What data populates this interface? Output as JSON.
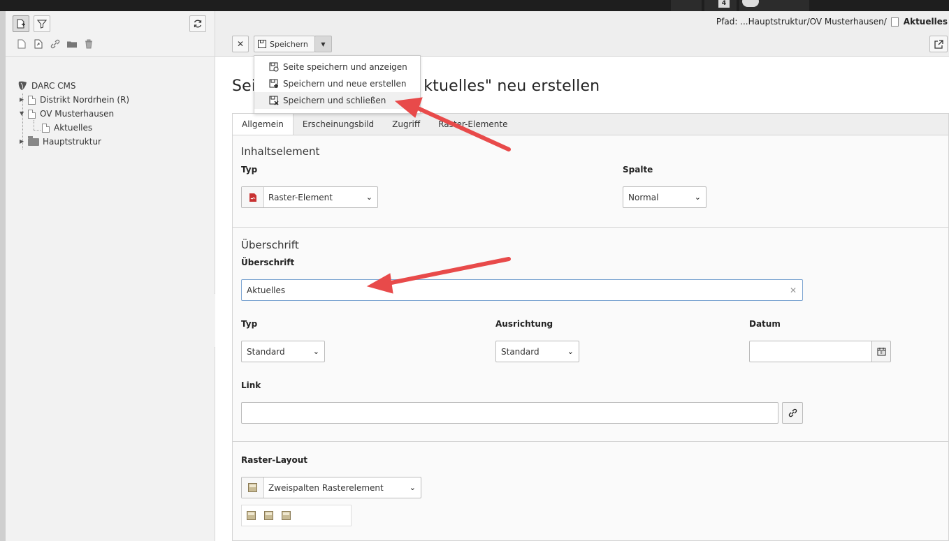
{
  "topbar": {
    "badge": "4"
  },
  "tree": {
    "root": "DARC CMS",
    "items": [
      {
        "label": "Distrikt Nordrhein (R)"
      },
      {
        "label": "OV Musterhausen"
      },
      {
        "label": "Aktuelles"
      },
      {
        "label": "Hauptstruktur"
      }
    ]
  },
  "header": {
    "path_prefix": "Pfad: ...Hauptstruktur/OV Musterhausen/",
    "path_current": "Aktuelles",
    "close_label": "✕",
    "save_label": "Speichern"
  },
  "save_menu": {
    "items": [
      {
        "label": "Seite speichern und anzeigen"
      },
      {
        "label": "Speichern und neue erstellen"
      },
      {
        "label": "Speichern und schließen"
      }
    ]
  },
  "page": {
    "title_visible_left": "Sei",
    "title_visible_right": "ktuelles\" neu erstellen"
  },
  "tabs": [
    {
      "label": "Allgemein"
    },
    {
      "label": "Erscheinungsbild"
    },
    {
      "label": "Zugriff"
    },
    {
      "label": "Raster-Elemente"
    }
  ],
  "form": {
    "inhalt_section": "Inhaltselement",
    "typ_label": "Typ",
    "typ_value": "Raster-Element",
    "spalte_label": "Spalte",
    "spalte_value": "Normal",
    "ueberschrift_section": "Überschrift",
    "ueberschrift_label": "Überschrift",
    "ueberschrift_value": "Aktuelles",
    "htyp_label": "Typ",
    "htyp_value": "Standard",
    "ausrichtung_label": "Ausrichtung",
    "ausrichtung_value": "Standard",
    "datum_label": "Datum",
    "datum_value": "",
    "link_label": "Link",
    "link_value": "",
    "raster_label": "Raster-Layout",
    "raster_value": "Zweispalten Rasterelement"
  },
  "colors": {
    "arrow": "#e84a4a",
    "topbar": "#1e1e1e",
    "panel": "#f2f2f2"
  }
}
